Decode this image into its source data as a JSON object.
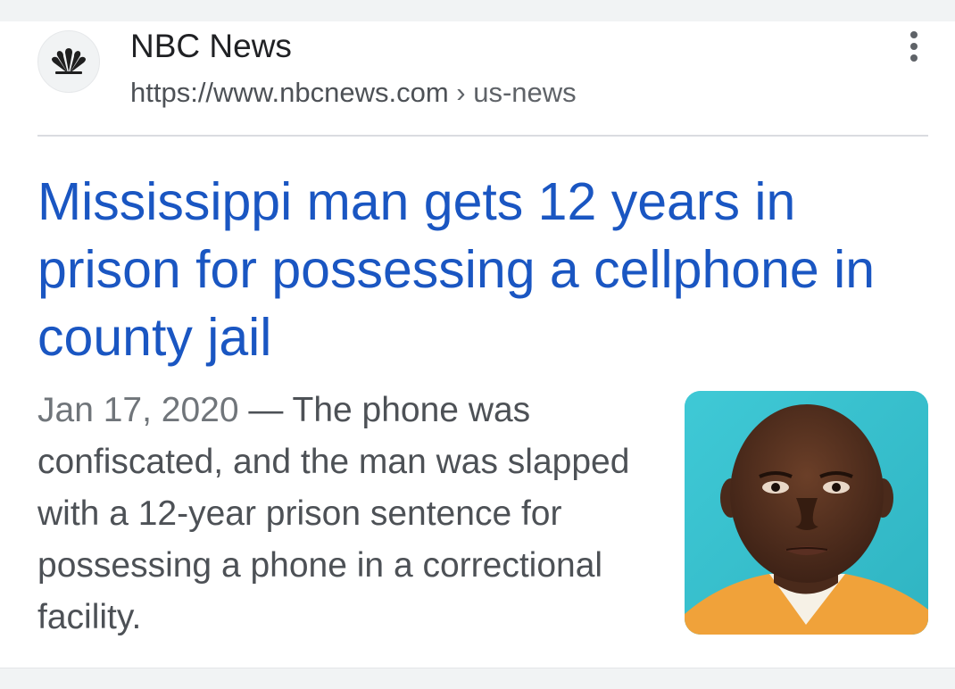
{
  "result": {
    "favicon_icon": "nbc-peacock-icon",
    "site_name": "NBC News",
    "url_domain": "https://www.nbcnews.com",
    "url_separator": "›",
    "url_path": "us-news",
    "more_icon": "more-vert-icon",
    "title": "Mississippi man gets 12 years in prison for possessing a cellphone in county jail",
    "snippet_date": "Jan 17, 2020",
    "snippet_dash": " — ",
    "snippet_text": "The phone was confiscated, and the man was slapped with a 12-year prison sentence for possessing a phone in a correctional facility.",
    "thumbnail_icon": "mugshot-photo"
  },
  "colors": {
    "title_link": "#1a56c2",
    "body_text": "#4d5156",
    "site_name": "#202124",
    "thumbnail_background": "#37c0ce"
  }
}
